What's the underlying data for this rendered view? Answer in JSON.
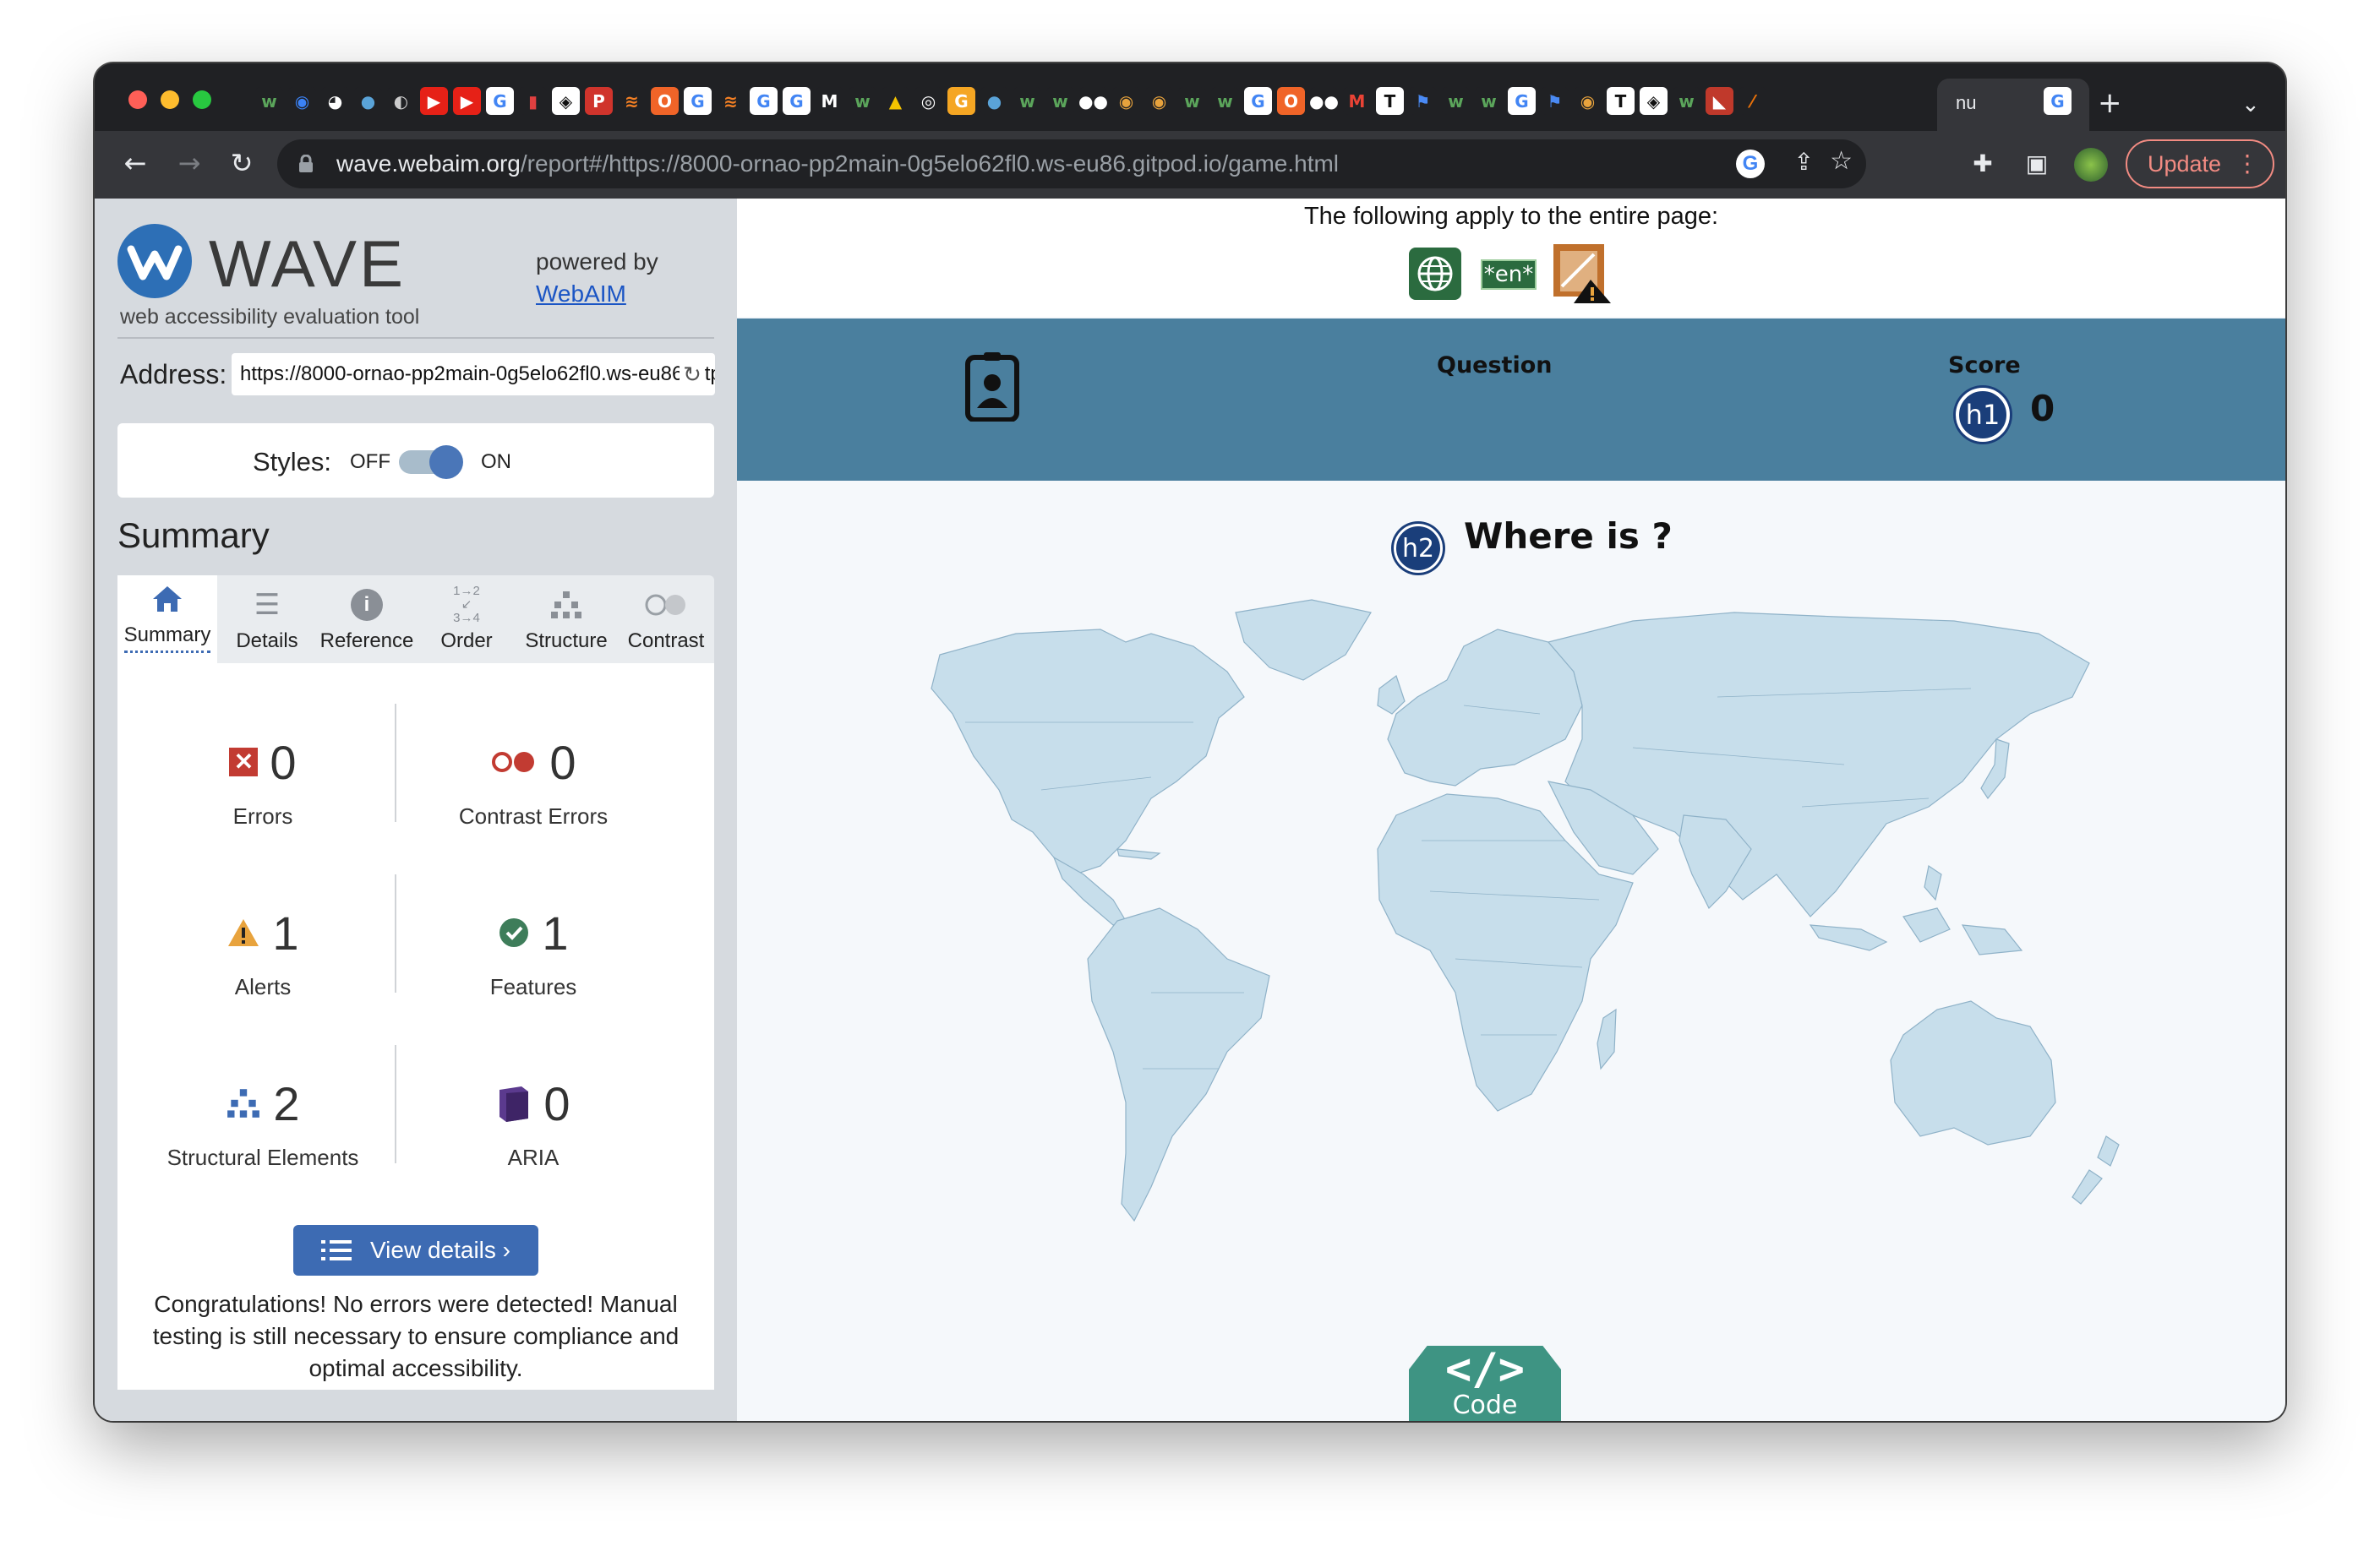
{
  "browser": {
    "tab_title": "nu",
    "url_host": "wave.webaim.org",
    "url_path": "/report#/https://8000-ornao-pp2main-0g5elo62fl0.ws-eu86.gitpod.io/game.html",
    "update_label": "Update",
    "favicons": [
      {
        "glyph": "w",
        "bg": "#202124",
        "fg": "#5ba55b"
      },
      {
        "glyph": "◉",
        "bg": "#202124",
        "fg": "#3b82f6"
      },
      {
        "glyph": "◕",
        "bg": "#202124",
        "fg": "#ffffff"
      },
      {
        "glyph": "●",
        "bg": "#202124",
        "fg": "#5aa3d8"
      },
      {
        "glyph": "◐",
        "bg": "#202124",
        "fg": "#cccccc"
      },
      {
        "glyph": "▶",
        "bg": "#e62117",
        "fg": "#ffffff"
      },
      {
        "glyph": "▶",
        "bg": "#e62117",
        "fg": "#ffffff"
      },
      {
        "glyph": "G",
        "bg": "#ffffff",
        "fg": "#4285f4"
      },
      {
        "glyph": "▮",
        "bg": "#202124",
        "fg": "#e04040"
      },
      {
        "glyph": "◈",
        "bg": "#ffffff",
        "fg": "#111111"
      },
      {
        "glyph": "P",
        "bg": "#d0342c",
        "fg": "#ffffff"
      },
      {
        "glyph": "≋",
        "bg": "#202124",
        "fg": "#f48024"
      },
      {
        "glyph": "O",
        "bg": "#f06428",
        "fg": "#ffffff"
      },
      {
        "glyph": "G",
        "bg": "#ffffff",
        "fg": "#4285f4"
      },
      {
        "glyph": "≋",
        "bg": "#202124",
        "fg": "#f48024"
      },
      {
        "glyph": "G",
        "bg": "#ffffff",
        "fg": "#4285f4"
      },
      {
        "glyph": "G",
        "bg": "#ffffff",
        "fg": "#4285f4"
      },
      {
        "glyph": "M",
        "bg": "#202124",
        "fg": "#ffffff"
      },
      {
        "glyph": "w",
        "bg": "#202124",
        "fg": "#5ba55b"
      },
      {
        "glyph": "▲",
        "bg": "#202124",
        "fg": "#f5c400"
      },
      {
        "glyph": "◎",
        "bg": "#202124",
        "fg": "#ffffff"
      },
      {
        "glyph": "G",
        "bg": "#f5a623",
        "fg": "#ffffff"
      },
      {
        "glyph": "●",
        "bg": "#202124",
        "fg": "#5aa3d8"
      },
      {
        "glyph": "w",
        "bg": "#202124",
        "fg": "#5ba55b"
      },
      {
        "glyph": "w",
        "bg": "#202124",
        "fg": "#5ba55b"
      },
      {
        "glyph": "●●",
        "bg": "#202124",
        "fg": "#ffffff"
      },
      {
        "glyph": "◉",
        "bg": "#202124",
        "fg": "#e8a33d"
      },
      {
        "glyph": "◉",
        "bg": "#202124",
        "fg": "#e8a33d"
      },
      {
        "glyph": "w",
        "bg": "#202124",
        "fg": "#5ba55b"
      },
      {
        "glyph": "w",
        "bg": "#202124",
        "fg": "#5ba55b"
      },
      {
        "glyph": "G",
        "bg": "#ffffff",
        "fg": "#4285f4"
      },
      {
        "glyph": "O",
        "bg": "#f06428",
        "fg": "#ffffff"
      },
      {
        "glyph": "●●",
        "bg": "#202124",
        "fg": "#ffffff"
      },
      {
        "glyph": "M",
        "bg": "#202124",
        "fg": "#ea4335"
      },
      {
        "glyph": "T",
        "bg": "#ffffff",
        "fg": "#111111"
      },
      {
        "glyph": "⚑",
        "bg": "#202124",
        "fg": "#4a8af4"
      },
      {
        "glyph": "w",
        "bg": "#202124",
        "fg": "#5ba55b"
      },
      {
        "glyph": "w",
        "bg": "#202124",
        "fg": "#5ba55b"
      },
      {
        "glyph": "G",
        "bg": "#ffffff",
        "fg": "#4285f4"
      },
      {
        "glyph": "⚑",
        "bg": "#202124",
        "fg": "#4a8af4"
      },
      {
        "glyph": "◉",
        "bg": "#202124",
        "fg": "#e8a33d"
      },
      {
        "glyph": "T",
        "bg": "#ffffff",
        "fg": "#111111"
      },
      {
        "glyph": "◈",
        "bg": "#ffffff",
        "fg": "#111111"
      },
      {
        "glyph": "w",
        "bg": "#202124",
        "fg": "#5ba55b"
      },
      {
        "glyph": "◣",
        "bg": "#c0392b",
        "fg": "#ffffff"
      },
      {
        "glyph": "⁄",
        "bg": "#202124",
        "fg": "#e8710a"
      }
    ]
  },
  "wave": {
    "logo_word": "WAVE",
    "logo_sub": "web accessibility evaluation tool",
    "powered_by": "powered by",
    "powered_link": "WebAIM",
    "address_label": "Address:",
    "address_value": "https://8000-ornao-pp2main-0g5elo62fl0.ws-eu86.gitpod.io/game.html",
    "styles_label": "Styles:",
    "styles_off": "OFF",
    "styles_on": "ON",
    "styles_enabled": true,
    "summary_title": "Summary",
    "tabs": [
      {
        "label": "Summary",
        "icon": "home-icon",
        "active": true
      },
      {
        "label": "Details",
        "icon": "list-icon",
        "active": false
      },
      {
        "label": "Reference",
        "icon": "info-icon",
        "active": false
      },
      {
        "label": "Order",
        "icon": "order-icon",
        "active": false
      },
      {
        "label": "Structure",
        "icon": "structure-icon",
        "active": false
      },
      {
        "label": "Contrast",
        "icon": "contrast-icon",
        "active": false
      }
    ],
    "stats": {
      "errors": {
        "value": "0",
        "label": "Errors"
      },
      "contrast_errors": {
        "value": "0",
        "label": "Contrast Errors"
      },
      "alerts": {
        "value": "1",
        "label": "Alerts"
      },
      "features": {
        "value": "1",
        "label": "Features"
      },
      "structural": {
        "value": "2",
        "label": "Structural Elements"
      },
      "aria": {
        "value": "0",
        "label": "ARIA"
      }
    },
    "view_details": "View details ›",
    "congrats": "Congratulations! No errors were detected! Manual testing is still necessary to ensure compliance and optimal accessibility."
  },
  "page": {
    "apply_text": "The following apply to the entire page:",
    "lang_badge": "*en*",
    "question_label": "Question",
    "score_label": "Score",
    "score_value": "0",
    "h1_badge": "h1",
    "h2_badge": "h2",
    "heading": "Where is ?",
    "code_label": "Code",
    "code_glyph": "</>"
  },
  "colors": {
    "header_bg": "#4a7f9e",
    "map_land": "#c7deeb",
    "code_button": "#3e9483",
    "wave_blue": "#2d6fb6"
  }
}
